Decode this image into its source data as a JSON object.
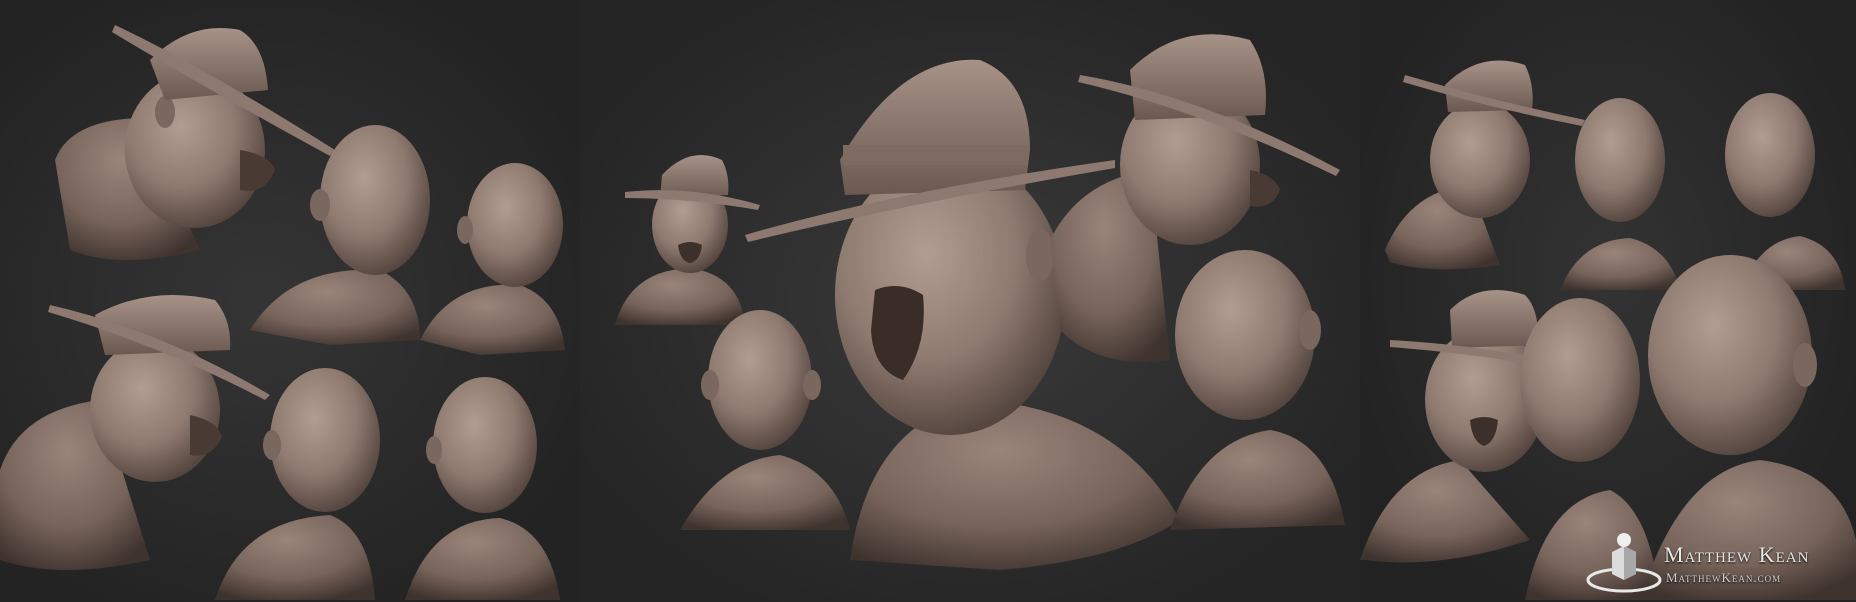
{
  "image": {
    "subject": "clay sculpt turnaround",
    "colors": {
      "background": "#262626",
      "clay": "#8f7a70",
      "clay_shadow": "#5a4a43",
      "clay_highlight": "#b29d92"
    }
  },
  "watermark": {
    "name": "Matthew Kean",
    "url": "MatthewKean.com"
  }
}
